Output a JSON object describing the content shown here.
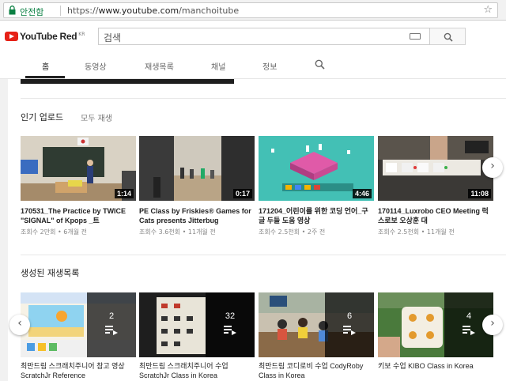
{
  "browser": {
    "secure_label": "안전함",
    "url_prefix": "https://",
    "url_host": "www.youtube.com",
    "url_path": "/manchoitube"
  },
  "masthead": {
    "logo_text": "YouTube Red",
    "logo_region": "KR",
    "search_placeholder": "검색"
  },
  "tabs": [
    {
      "label": "홈",
      "active": true
    },
    {
      "label": "동영상"
    },
    {
      "label": "재생목록"
    },
    {
      "label": "채널"
    },
    {
      "label": "정보"
    }
  ],
  "popular": {
    "title": "인기 업로드",
    "play_all": "모두 재생",
    "videos": [
      {
        "title": "170531_The Practice by TWICE \"SIGNAL\" of Kpops _트",
        "views": "조회수 2만회",
        "age": "6개월 전",
        "duration": "1:14"
      },
      {
        "title": "PE Class by Friskies® Games for Cats presents Jitterbug",
        "views": "조회수 3.6천회",
        "age": "11개월 전",
        "duration": "0:17"
      },
      {
        "title": "171204_어린이를 위한 코딩 언어_구글 두들 도움 영상",
        "views": "조회수 2.5천회",
        "age": "2주 전",
        "duration": "4:46"
      },
      {
        "title": "170114_Luxrobo CEO Meeting 럭스로보 오상훈 대",
        "views": "조회수 2.5천회",
        "age": "11개월 전",
        "duration": "11:08"
      }
    ]
  },
  "playlists": {
    "title": "생성된 재생목록",
    "items": [
      {
        "title": "최만드림 스크래치주니어 참고 영상 ScratchJr Reference",
        "count": "2"
      },
      {
        "title": "최만드림 스크래치주니어 수업 ScratchJr Class in Korea",
        "count": "32"
      },
      {
        "title": "최만드림 코디로비 수업 CodyRoby Class in Korea",
        "count": "6"
      },
      {
        "title": "키보 수업 KIBO Class in Korea",
        "count": "4"
      }
    ]
  },
  "colors": {
    "brand_red": "#e62117",
    "secure_green": "#0b8043",
    "text_primary": "#222222",
    "text_secondary": "#888888"
  }
}
